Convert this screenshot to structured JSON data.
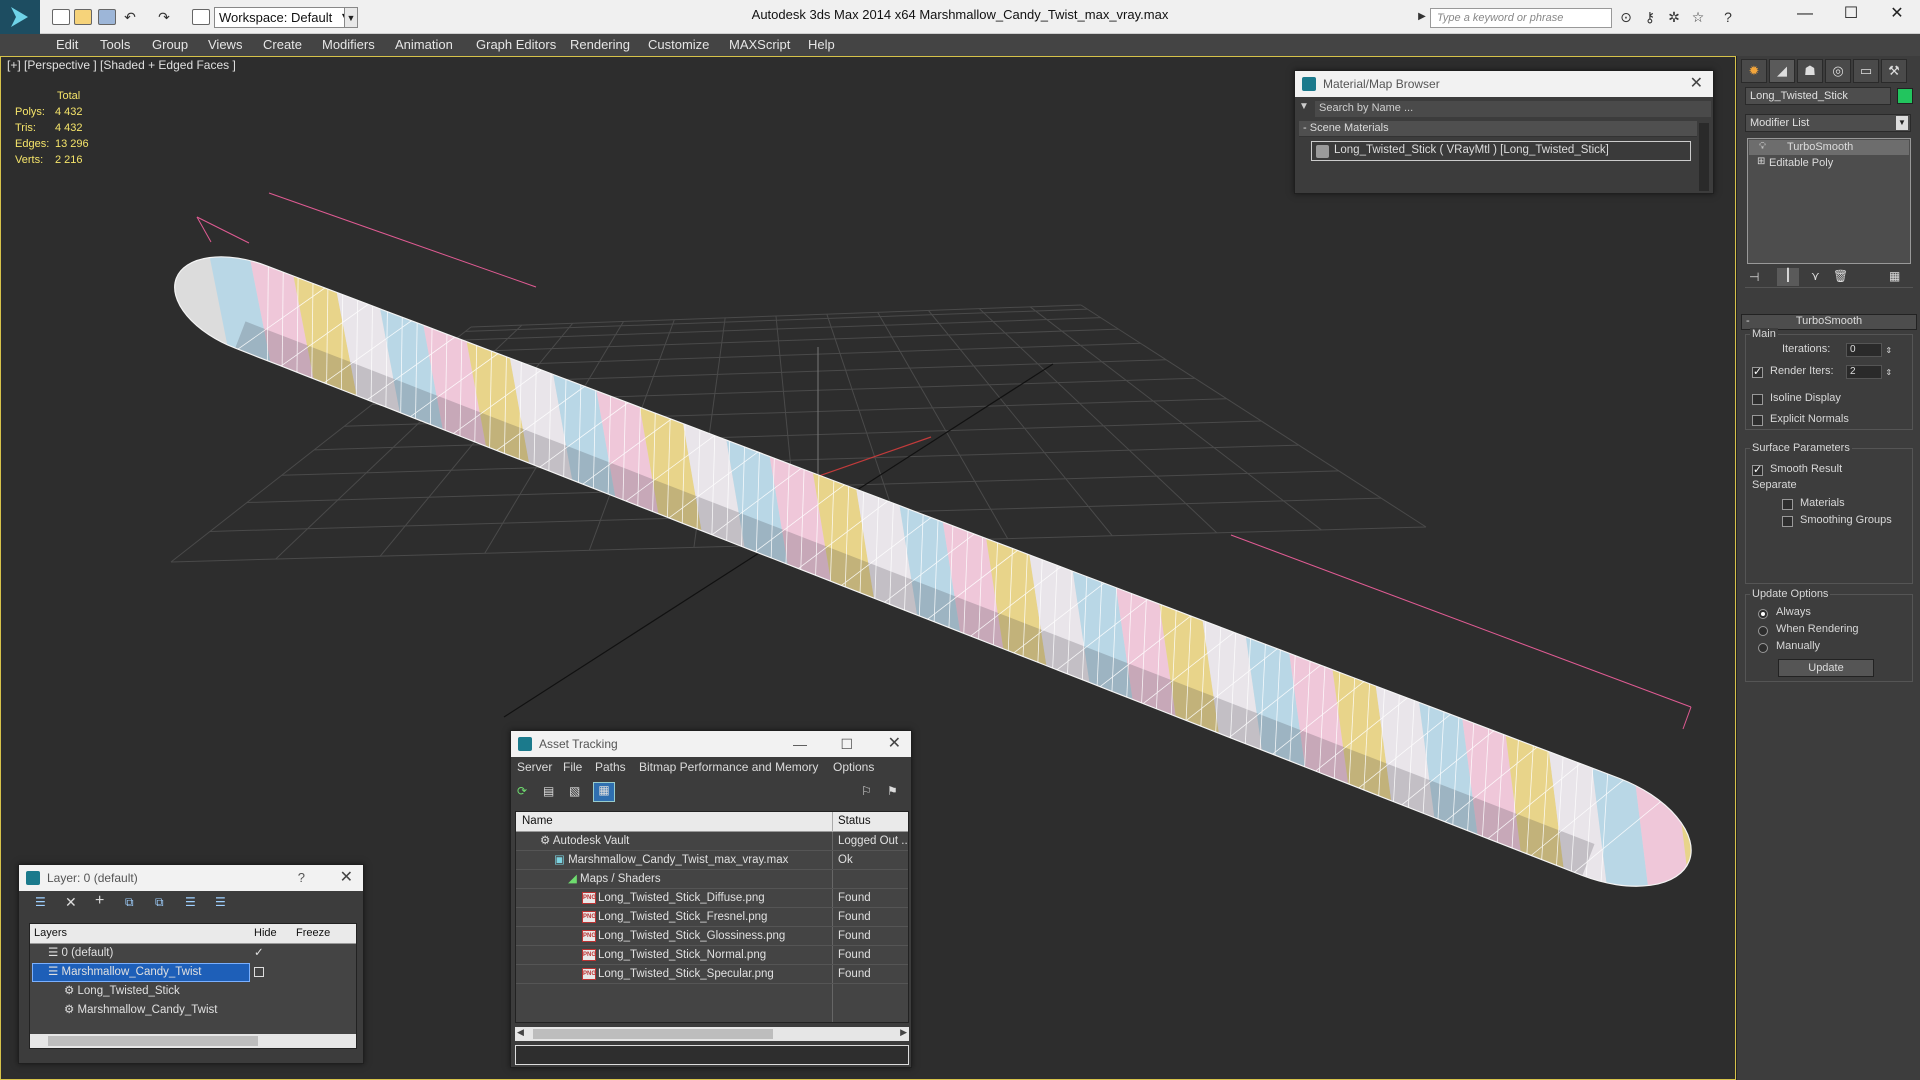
{
  "window": {
    "title": "Autodesk 3ds Max  2014 x64      Marshmallow_Candy_Twist_max_vray.max",
    "workspace": "Workspace: Default",
    "search_placeholder": "Type a keyword or phrase"
  },
  "menu": [
    "Edit",
    "Tools",
    "Group",
    "Views",
    "Create",
    "Modifiers",
    "Animation",
    "Graph Editors",
    "Rendering",
    "Customize",
    "MAXScript",
    "Help"
  ],
  "viewport": {
    "label": "[+] [Perspective ] [Shaded + Edged Faces ]",
    "stats": {
      "header": "Total",
      "rows": [
        {
          "label": "Polys:",
          "value": "4 432"
        },
        {
          "label": "Tris:",
          "value": "4 432"
        },
        {
          "label": "Edges:",
          "value": "13 296"
        },
        {
          "label": "Verts:",
          "value": "2 216"
        }
      ]
    },
    "stripe_colors": [
      "#b9d7e6",
      "#efc7d9",
      "#e8d48a",
      "#e9e5ea"
    ]
  },
  "material_browser": {
    "title": "Material/Map Browser",
    "search_placeholder": "Search by Name ...",
    "section": "Scene Materials",
    "item": "Long_Twisted_Stick  ( VRayMtl )  [Long_Twisted_Stick]"
  },
  "command_panel": {
    "object_name": "Long_Twisted_Stick",
    "object_color": "#22c55e",
    "modifier_list": "Modifier List",
    "stack": [
      "TurboSmooth",
      "Editable Poly"
    ],
    "rollout_title": "TurboSmooth",
    "main_label": "Main",
    "iterations_label": "Iterations:",
    "iterations_value": "0",
    "render_iters_label": "Render Iters:",
    "render_iters_value": "2",
    "isoline_label": "Isoline Display",
    "explicit_normals_label": "Explicit Normals",
    "surface_label": "Surface Parameters",
    "smooth_result_label": "Smooth Result",
    "separate_label": "Separate",
    "materials_label": "Materials",
    "smoothing_groups_label": "Smoothing Groups",
    "update_options_label": "Update Options",
    "always_label": "Always",
    "when_rendering_label": "When Rendering",
    "manually_label": "Manually",
    "update_button": "Update"
  },
  "layer_window": {
    "title": "Layer: 0 (default)",
    "help": "?",
    "col_layers": "Layers",
    "col_hide": "Hide",
    "col_freeze": "Freeze",
    "rows": [
      {
        "name": "0 (default)",
        "indent": 0
      },
      {
        "name": "Marshmallow_Candy_Twist",
        "indent": 0
      },
      {
        "name": "Long_Twisted_Stick",
        "indent": 1
      },
      {
        "name": "Marshmallow_Candy_Twist",
        "indent": 1
      }
    ]
  },
  "asset_tracking": {
    "title": "Asset Tracking",
    "menu": [
      "Server",
      "File",
      "Paths",
      "Bitmap Performance and Memory",
      "Options"
    ],
    "col_name": "Name",
    "col_status": "Status",
    "rows": [
      {
        "name": "Autodesk Vault",
        "status": "Logged Out ..",
        "indent": 1
      },
      {
        "name": "Marshmallow_Candy_Twist_max_vray.max",
        "status": "Ok",
        "indent": 2
      },
      {
        "name": "Maps / Shaders",
        "status": "",
        "indent": 3
      },
      {
        "name": "Long_Twisted_Stick_Diffuse.png",
        "status": "Found",
        "indent": 4
      },
      {
        "name": "Long_Twisted_Stick_Fresnel.png",
        "status": "Found",
        "indent": 4
      },
      {
        "name": "Long_Twisted_Stick_Glossiness.png",
        "status": "Found",
        "indent": 4
      },
      {
        "name": "Long_Twisted_Stick_Normal.png",
        "status": "Found",
        "indent": 4
      },
      {
        "name": "Long_Twisted_Stick_Specular.png",
        "status": "Found",
        "indent": 4
      }
    ]
  }
}
